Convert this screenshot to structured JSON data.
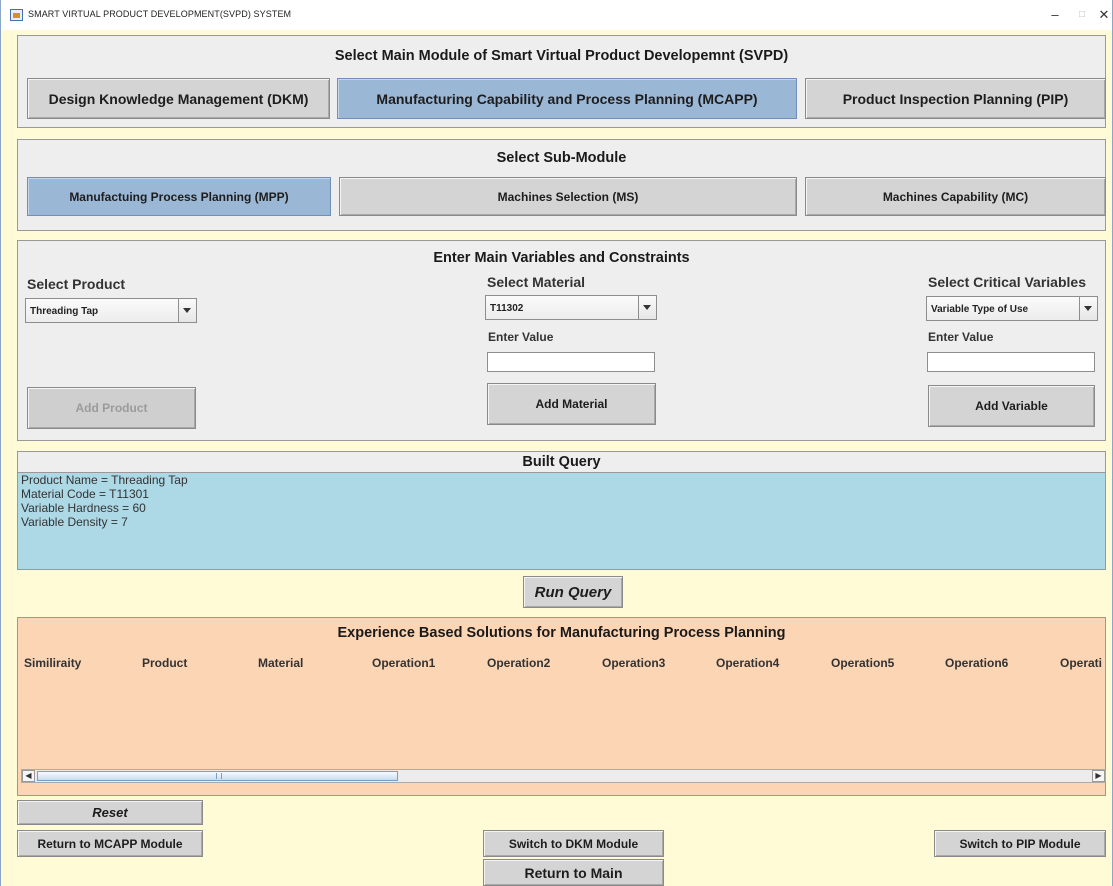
{
  "window": {
    "title": "SMART VIRTUAL PRODUCT DEVELOPMENT(SVPD) SYSTEM",
    "minimize": "–",
    "maximize": "□",
    "close": "✕"
  },
  "main_module": {
    "title": "Select Main Module of Smart Virtual Product Developemnt (SVPD)",
    "buttons": [
      {
        "label": "Design Knowledge Management (DKM)"
      },
      {
        "label": "Manufacturing Capability and Process Planning (MCAPP)",
        "selected": true
      },
      {
        "label": "Product Inspection Planning (PIP)"
      }
    ]
  },
  "sub_module": {
    "title": "Select Sub-Module",
    "buttons": [
      {
        "label": "Manufactuing Process Planning (MPP)",
        "selected": true
      },
      {
        "label": "Machines Selection (MS)"
      },
      {
        "label": "Machines Capability (MC)"
      }
    ]
  },
  "variables": {
    "title": "Enter Main Variables and Constraints",
    "product": {
      "label": "Select Product",
      "selected": "Threading Tap",
      "add_button": "Add Product"
    },
    "material": {
      "label": "Select Material",
      "selected": "T11302",
      "enter_value_label": "Enter Value",
      "value": "",
      "add_button": "Add Material"
    },
    "critical": {
      "label": "Select Critical Variables",
      "selected": "Variable Type of Use",
      "enter_value_label": "Enter Value",
      "value": "",
      "add_button": "Add Variable"
    }
  },
  "query": {
    "title": "Built Query",
    "lines": [
      "Product Name = Threading Tap",
      "Material Code = T11301",
      "Variable Hardness = 60",
      "Variable Density = 7"
    ],
    "run_button": "Run Query"
  },
  "results": {
    "title": "Experience Based Solutions for Manufacturing Process Planning",
    "columns": [
      "Similiraity",
      "Product",
      "Material",
      "Operation1",
      "Operation2",
      "Operation3",
      "Operation4",
      "Operation5",
      "Operation6",
      "Operati"
    ]
  },
  "footer": {
    "reset": "Reset",
    "return_mcapp": "Return to MCAPP Module",
    "switch_dkm": "Switch to DKM Module",
    "switch_pip": "Switch to PIP Module",
    "return_main": "Return to Main"
  },
  "colors": {
    "background": "#fffbd6",
    "selected_button": "#9bb7d6",
    "query_area": "#add8e6",
    "results_area": "#fcd5b4"
  }
}
